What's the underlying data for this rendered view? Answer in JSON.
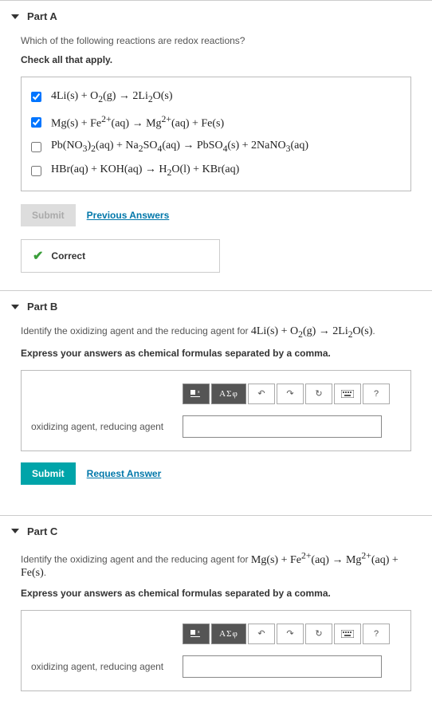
{
  "partA": {
    "title": "Part A",
    "question": "Which of the following reactions are redox reactions?",
    "instruction": "Check all that apply.",
    "options": [
      {
        "checked": true,
        "html": "4Li(s) + O<sub>2</sub>(g) → 2Li<sub>2</sub>O(s)"
      },
      {
        "checked": true,
        "html": "Mg(s) + Fe<sup>2+</sup>(aq) → Mg<sup>2+</sup>(aq) + Fe(s)"
      },
      {
        "checked": false,
        "html": "Pb(NO<sub>3</sub>)<sub>2</sub>(aq) + Na<sub>2</sub>SO<sub>4</sub>(aq) → PbSO<sub>4</sub>(s) + 2NaNO<sub>3</sub>(aq)"
      },
      {
        "checked": false,
        "html": "HBr(aq) + KOH(aq) → H<sub>2</sub>O(l) + KBr(aq)"
      }
    ],
    "submitLabel": "Submit",
    "prevAnswers": "Previous Answers",
    "correctLabel": "Correct"
  },
  "partB": {
    "title": "Part B",
    "question_pre": "Identify the oxidizing agent and the reducing agent for ",
    "question_eq": "4Li(s) + O<sub>2</sub>(g) → 2Li<sub>2</sub>O(s)",
    "question_post": ".",
    "instruction": "Express your answers as chemical formulas separated by a comma.",
    "answerLabel": "oxidizing agent, reducing agent",
    "inputValue": "",
    "submitLabel": "Submit",
    "requestAnswer": "Request Answer"
  },
  "partC": {
    "title": "Part C",
    "question_pre": "Identify the oxidizing agent and the reducing agent for ",
    "question_eq": "Mg(s) + Fe<sup>2+</sup>(aq) → Mg<sup>2+</sup>(aq) + Fe(s)",
    "question_post": ".",
    "instruction": "Express your answers as chemical formulas separated by a comma.",
    "answerLabel": "oxidizing agent, reducing agent",
    "inputValue": ""
  },
  "toolbar": {
    "templates": "ΑΣφ",
    "help": "?"
  }
}
